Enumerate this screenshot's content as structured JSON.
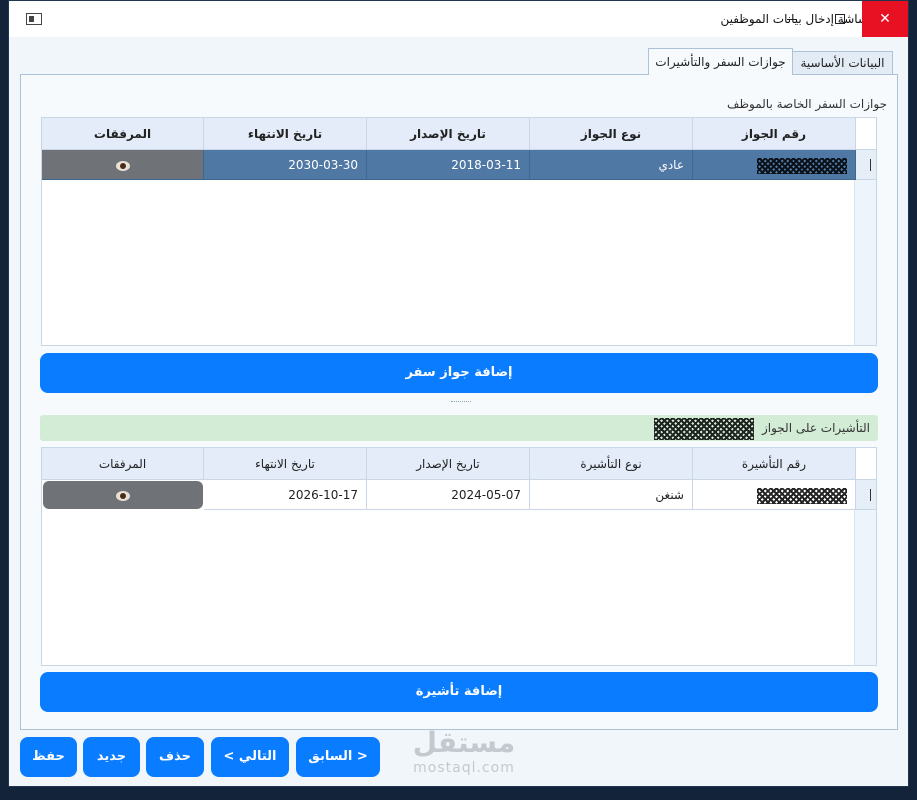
{
  "window": {
    "title": "شاشة إدخال بيانات الموظفين",
    "min_glyph": "",
    "close_glyph": "✕"
  },
  "tabs": [
    {
      "label": "البيانات الأساسية"
    },
    {
      "label": "جوازات السفر والتأشيرات"
    }
  ],
  "passports": {
    "section_label": "جوازات السفر الخاصة بالموظف",
    "columns": [
      "رقم الجواز",
      "نوع الجواز",
      "تاريخ الإصدار",
      "تاريخ الانتهاء",
      "المرفقات"
    ],
    "rows": [
      {
        "number": "",
        "type": "عادي",
        "issue_date": "2018-03-11",
        "expiry_date": "2030-03-30",
        "attachment_icon": "eye-icon"
      }
    ],
    "add_button": "إضافة جواز سفر"
  },
  "visas": {
    "banner_label": "التأشيرات على الجواز",
    "columns": [
      "رقم التأشيرة",
      "نوع التأشيرة",
      "تاريخ الإصدار",
      "تاريخ الانتهاء",
      "المرفقات"
    ],
    "rows": [
      {
        "number": "",
        "type": "شنغن",
        "issue_date": "2024-05-07",
        "expiry_date": "2026-10-17",
        "attachment_icon": "eye-icon"
      }
    ],
    "add_button": "إضافة تأشيرة"
  },
  "footer": {
    "save": "حفظ",
    "new": "جديد",
    "delete": "حذف",
    "next": "التالي >",
    "prev": "< السابق"
  },
  "watermark": {
    "arabic": "مستقل",
    "latin": "mostaql.com"
  },
  "colors": {
    "accent": "#0a7cff",
    "selected_row": "#4f79a4",
    "close": "#e81123",
    "banner": "#d3ecd6"
  }
}
